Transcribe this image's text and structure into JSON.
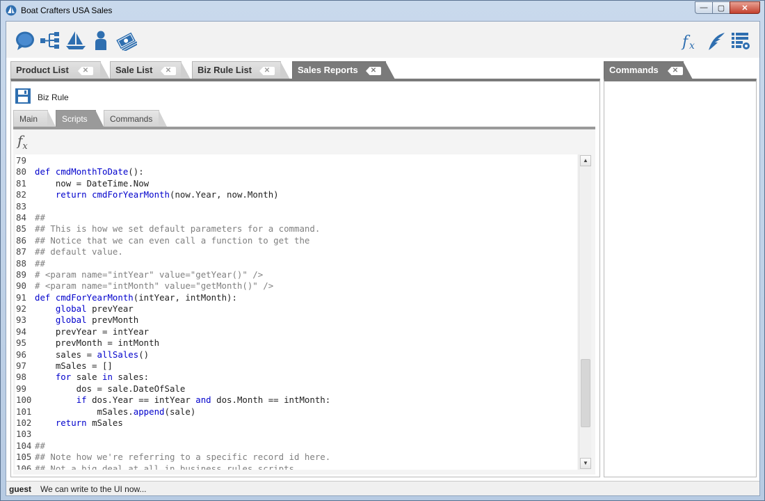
{
  "window": {
    "title": "Boat Crafters USA Sales"
  },
  "window_controls": {
    "minimize": "—",
    "maximize": "▢",
    "close": "✕"
  },
  "toolbar": {
    "left_icons": [
      "chat-bubble-icon",
      "hierarchy-icon",
      "sailboat-icon",
      "person-icon",
      "money-icon"
    ],
    "right_icons": [
      "fx-function-icon",
      "quill-pen-icon",
      "list-settings-icon"
    ],
    "accent": "#2f6fb0"
  },
  "document_tabs": [
    {
      "label": "Product List",
      "active": false
    },
    {
      "label": "Sale List",
      "active": false
    },
    {
      "label": "Biz Rule List",
      "active": false
    },
    {
      "label": "Sales Reports",
      "active": true
    }
  ],
  "right_tabs": [
    {
      "label": "Commands",
      "active": true
    }
  ],
  "doc_header": {
    "label": "Biz Rule"
  },
  "sub_tabs": [
    {
      "label": "Main",
      "active": false
    },
    {
      "label": "Scripts",
      "active": true
    },
    {
      "label": "Commands",
      "active": false
    }
  ],
  "editor": {
    "fx_label": "f",
    "fx_sub": "x",
    "lines": [
      {
        "n": "79",
        "code": ""
      },
      {
        "n": "80",
        "code": "def cmdMonthToDate():"
      },
      {
        "n": "81",
        "code": "    now = DateTime.Now"
      },
      {
        "n": "82",
        "code": "    return cmdForYearMonth(now.Year, now.Month)"
      },
      {
        "n": "83",
        "code": ""
      },
      {
        "n": "84",
        "code": "##"
      },
      {
        "n": "85",
        "code": "## This is how we set default parameters for a command."
      },
      {
        "n": "86",
        "code": "## Notice that we can even call a function to get the"
      },
      {
        "n": "87",
        "code": "## default value."
      },
      {
        "n": "88",
        "code": "##"
      },
      {
        "n": "89",
        "code": "# <param name=\"intYear\" value=\"getYear()\" />"
      },
      {
        "n": "90",
        "code": "# <param name=\"intMonth\" value=\"getMonth()\" />"
      },
      {
        "n": "91",
        "code": "def cmdForYearMonth(intYear, intMonth):"
      },
      {
        "n": "92",
        "code": "    global prevYear"
      },
      {
        "n": "93",
        "code": "    global prevMonth"
      },
      {
        "n": "94",
        "code": "    prevYear = intYear"
      },
      {
        "n": "95",
        "code": "    prevMonth = intMonth"
      },
      {
        "n": "96",
        "code": "    sales = allSales()"
      },
      {
        "n": "97",
        "code": "    mSales = []"
      },
      {
        "n": "98",
        "code": "    for sale in sales:"
      },
      {
        "n": "99",
        "code": "        dos = sale.DateOfSale"
      },
      {
        "n": "100",
        "code": "        if dos.Year == intYear and dos.Month == intMonth:"
      },
      {
        "n": "101",
        "code": "            mSales.append(sale)"
      },
      {
        "n": "102",
        "code": "    return mSales"
      },
      {
        "n": "103",
        "code": ""
      },
      {
        "n": "104",
        "code": "##"
      },
      {
        "n": "105",
        "code": "## Note how we're referring to a specific record id here."
      },
      {
        "n": "106",
        "code": "## Not a big deal at all in business rules scripts"
      }
    ],
    "colors": {
      "keyword": "#0000cc",
      "comment": "#808080",
      "text": "#222222"
    }
  },
  "status": {
    "user": "guest",
    "message": "We can write to the UI now..."
  }
}
